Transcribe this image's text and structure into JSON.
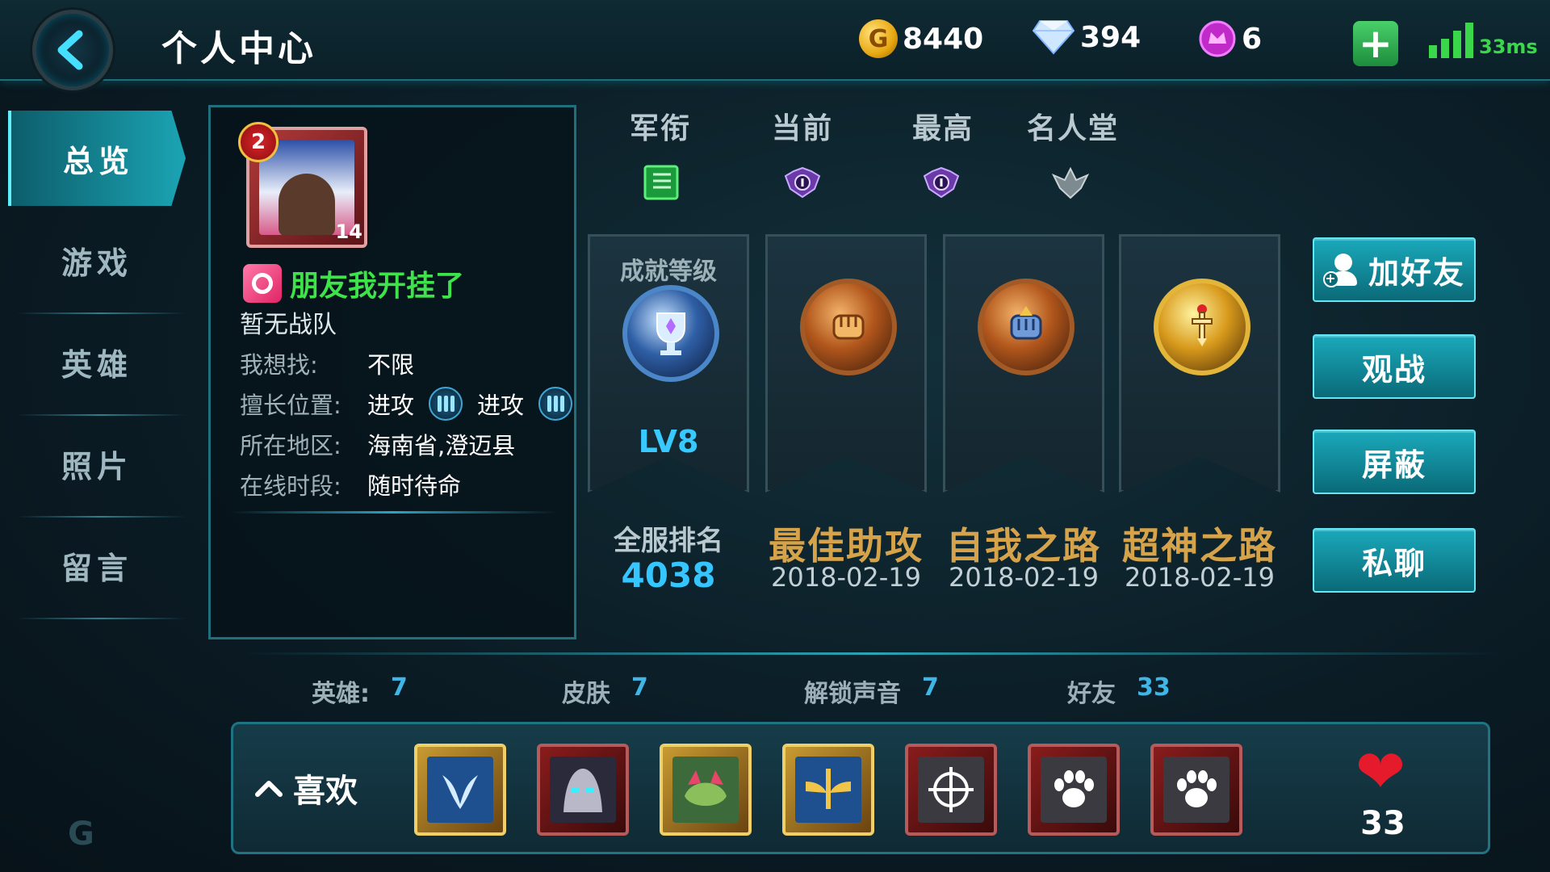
{
  "header": {
    "title": "个人中心",
    "gold": "8440",
    "diamonds": "394",
    "gems": "6",
    "ping": "33ms",
    "gold_glyph": "G",
    "plus_glyph": "+"
  },
  "sidebar": {
    "items": [
      {
        "label": "总览",
        "active": true
      },
      {
        "label": "游戏",
        "active": false
      },
      {
        "label": "英雄",
        "active": false
      },
      {
        "label": "照片",
        "active": false
      },
      {
        "label": "留言",
        "active": false
      }
    ]
  },
  "profile": {
    "avatar_badge": "2",
    "avatar_level": "14",
    "nickname": "朋友我开挂了",
    "team": "暂无战队",
    "looking_for_label": "我想找:",
    "looking_for_value": "不限",
    "position_label": "擅长位置:",
    "position_1": "进攻",
    "position_2": "进攻",
    "region_label": "所在地区:",
    "region_value": "海南省,澄迈县",
    "online_label": "在线时段:",
    "online_value": "随时待命"
  },
  "ranks": {
    "headers": [
      "军衔",
      "当前",
      "最高",
      "名人堂"
    ]
  },
  "achievements": {
    "level_title": "成就等级",
    "level": "LV8",
    "rank_label": "全服排名",
    "rank_value": "4038",
    "medals": [
      {
        "name": "最佳助攻",
        "date": "2018-02-19"
      },
      {
        "name": "自我之路",
        "date": "2018-02-19"
      },
      {
        "name": "超神之路",
        "date": "2018-02-19"
      }
    ]
  },
  "actions": {
    "add_friend": "加好友",
    "spectate": "观战",
    "block": "屏蔽",
    "private_chat": "私聊"
  },
  "stats": {
    "heroes_label": "英雄:",
    "heroes": "7",
    "skins_label": "皮肤",
    "skins": "7",
    "voices_label": "解锁声音",
    "voices": "7",
    "friends_label": "好友",
    "friends": "33"
  },
  "likes": {
    "label": "喜欢",
    "count": "33",
    "heart_glyph": "❤"
  },
  "colors": {
    "accent": "#1aa9bb",
    "nickname": "#3ee24a",
    "medal_text": "#d7a34a",
    "rank_number": "#36c6ff"
  }
}
